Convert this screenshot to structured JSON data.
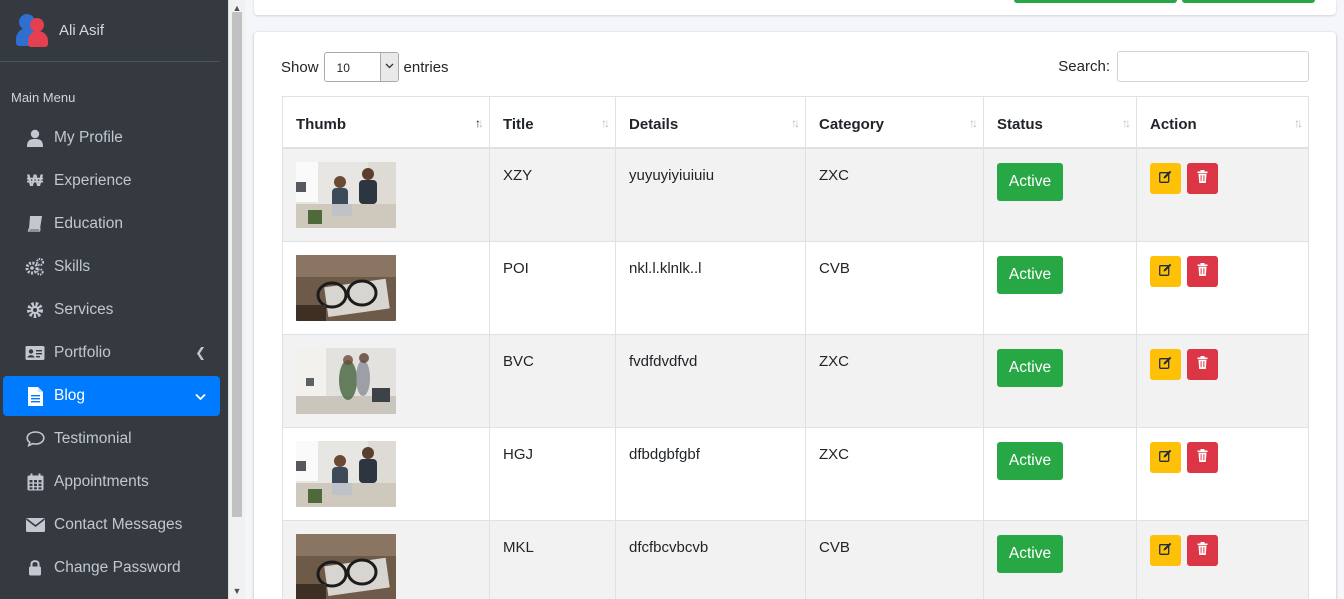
{
  "user": {
    "name": "Ali Asif"
  },
  "menu_header": "Main Menu",
  "sidebar": {
    "items": [
      {
        "label": "My Profile",
        "icon": "user-icon"
      },
      {
        "label": "Experience",
        "icon": "won-icon"
      },
      {
        "label": "Education",
        "icon": "book-icon"
      },
      {
        "label": "Skills",
        "icon": "cogs-icon"
      },
      {
        "label": "Services",
        "icon": "cog-icon"
      },
      {
        "label": "Portfolio",
        "icon": "id-card-icon"
      },
      {
        "label": "Blog",
        "icon": "file-icon"
      },
      {
        "label": "Testimonial",
        "icon": "comment-icon"
      },
      {
        "label": "Appointments",
        "icon": "calendar-icon"
      },
      {
        "label": "Contact Messages",
        "icon": "envelope-icon"
      },
      {
        "label": "Change Password",
        "icon": "lock-icon"
      }
    ]
  },
  "table_controls": {
    "show_label": "Show",
    "entries_value": "10",
    "entries_label": "entries",
    "search_label": "Search:"
  },
  "table": {
    "columns": [
      "Thumb",
      "Title",
      "Details",
      "Category",
      "Status",
      "Action"
    ],
    "rows": [
      {
        "title": "XZY",
        "details": "yuyuyiyiuiuiu",
        "category": "ZXC",
        "status": "Active"
      },
      {
        "title": "POI",
        "details": "nkl.l.klnlk..l",
        "category": "CVB",
        "status": "Active"
      },
      {
        "title": "BVC",
        "details": "fvdfdvdfvd",
        "category": "ZXC",
        "status": "Active"
      },
      {
        "title": "HGJ",
        "details": "dfbdgbfgbf",
        "category": "ZXC",
        "status": "Active"
      },
      {
        "title": "MKL",
        "details": "dfcfbcvbcvb",
        "category": "CVB",
        "status": "Active"
      }
    ]
  },
  "colors": {
    "sidebar_bg": "#343a40",
    "active_blue": "#007bff",
    "status_green": "#28a745",
    "edit_yellow": "#ffc107",
    "delete_red": "#dc3545"
  }
}
